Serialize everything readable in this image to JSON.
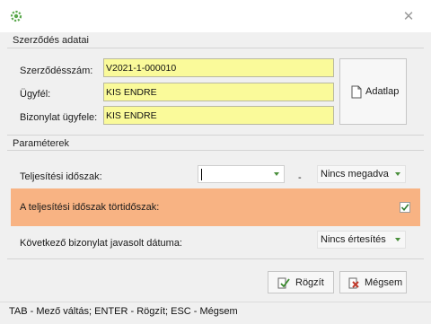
{
  "window": {
    "title": "",
    "app_icon": "gear-icon",
    "close_glyph": "✕"
  },
  "contract_section": {
    "title": "Szerződés adatai",
    "contract_number_label": "Szerződésszám:",
    "contract_number_value": "V2021-1-000010",
    "client_label": "Ügyfél:",
    "client_value": "KIS ENDRE",
    "document_client_label": "Bizonylat ügyfele:",
    "document_client_value": "KIS ENDRE",
    "datasheet_button": "Adatlap"
  },
  "parameters_section": {
    "title": "Paraméterek",
    "period_label": "Teljesítési időszak:",
    "period_value": "",
    "period_separator": "-",
    "period_type_value": "Nincs megadva",
    "partial_period_label": "A teljesítési időszak törtidőszak:",
    "partial_period_checked": true,
    "next_date_label": "Következő bizonylat javasolt dátuma:",
    "next_date_value": "Nincs értesítés"
  },
  "buttons": {
    "save": "Rögzít",
    "cancel": "Mégsem"
  },
  "status_bar": "TAB - Mező váltás; ENTER - Rögzít; ESC - Mégsem",
  "colors": {
    "highlight_row": "#f8b383",
    "input_yellow": "#fafa9a",
    "accent_green": "#4a8f3c",
    "cancel_red": "#c0392b"
  }
}
